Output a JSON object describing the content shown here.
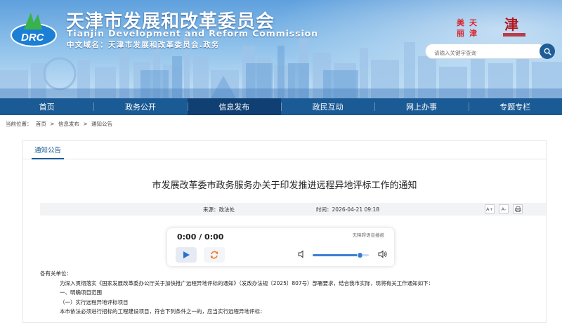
{
  "header": {
    "title_zh": "天津市发展和改革委员会",
    "title_en": "Tianjin Development and Reform Commission",
    "domain_line": "中文域名：天津市发展和改革委员会.政务",
    "logo_text": "DRC",
    "badge1_text": "美丽天津",
    "badge2_text": "天津"
  },
  "search": {
    "placeholder": "请输入关键字查询"
  },
  "nav": {
    "items": [
      "首页",
      "政务公开",
      "信息发布",
      "政民互动",
      "网上办事",
      "专题专栏"
    ],
    "active": "信息发布"
  },
  "breadcrumb": {
    "prefix": "当前位置：",
    "items": [
      "首页",
      ">",
      "信息发布",
      ">",
      "通知公告"
    ]
  },
  "tab": {
    "label": "通知公告"
  },
  "article": {
    "title": "市发展改革委市政务服务办关于印发推进远程异地评标工作的通知",
    "source": "来源：政法处",
    "time": "时间：2026-04-21 09:18",
    "tools": [
      "A+",
      "A-",
      "print-icon"
    ]
  },
  "player": {
    "time": "0:00 / 0:00",
    "label": "无障碍语音播报",
    "volume_level": 0.85
  },
  "body": {
    "salutation": "各有关单位：",
    "lines": [
      "为深入贯彻落实《国家发展改革委办公厅关于加快推广远程异地评标的通知》（发改办法规〔2025〕807号）部署要求，结合我市实际，现将有关工作通知如下：",
      "一、明确项目范围",
      "（一）实行远程异地评标项目",
      "本市依法必须进行招标的工程建设项目，符合下列条件之一的，应当实行远程异地评标："
    ]
  },
  "colors": {
    "nav_bg": "#1a5a95",
    "nav_active": "#0f3f73",
    "accent": "#3a7fd5"
  }
}
